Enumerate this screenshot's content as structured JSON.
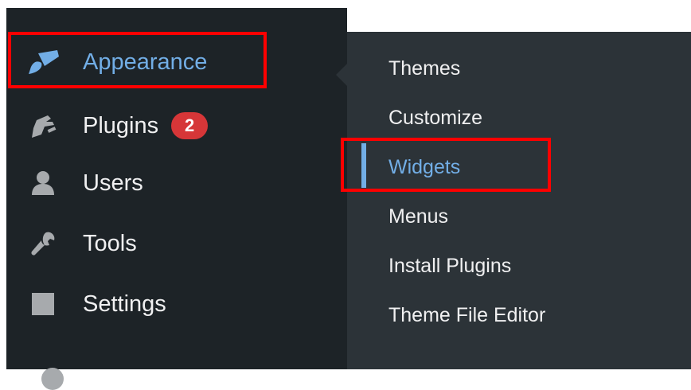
{
  "menu": {
    "appearance": {
      "label": "Appearance",
      "icon": "paintbrush-icon"
    },
    "plugins": {
      "label": "Plugins",
      "badge": "2",
      "icon": "plugin-icon"
    },
    "users": {
      "label": "Users",
      "icon": "users-icon"
    },
    "tools": {
      "label": "Tools",
      "icon": "wrench-icon"
    },
    "settings": {
      "label": "Settings",
      "icon": "settings-sliders-icon"
    }
  },
  "submenu": {
    "items": [
      {
        "label": "Themes"
      },
      {
        "label": "Customize"
      },
      {
        "label": "Widgets",
        "current": true
      },
      {
        "label": "Menus"
      },
      {
        "label": "Install Plugins"
      },
      {
        "label": "Theme File Editor"
      }
    ]
  },
  "colors": {
    "menu_bg": "#1d2327",
    "submenu_bg": "#2c3338",
    "accent": "#72aee6",
    "badge": "#d63638",
    "highlight": "#ff0000"
  }
}
